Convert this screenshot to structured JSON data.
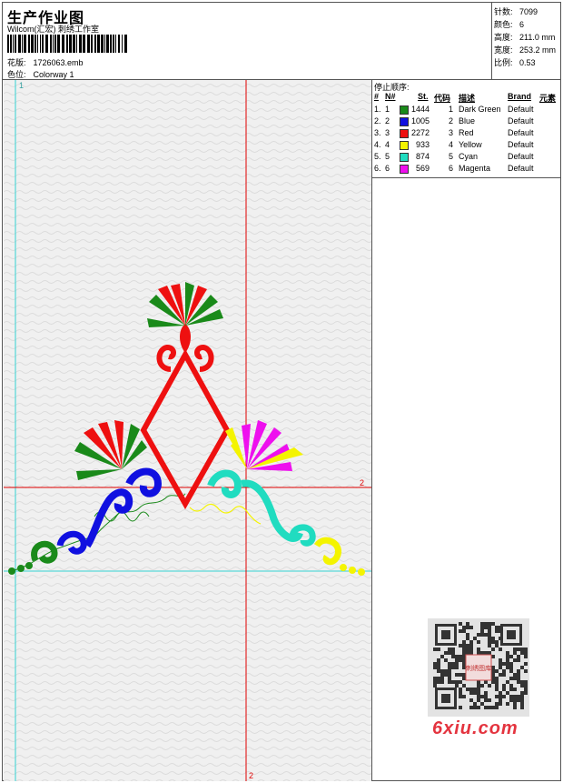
{
  "header": {
    "title": "生产作业图",
    "studio": "Wilcom(汇宏) 刺绣工作室",
    "design_label": "花版:",
    "design_file": "1726063.emb",
    "colorway_label": "色位:",
    "colorway": "Colorway 1"
  },
  "specs": [
    {
      "label": "针数:",
      "value": "7099"
    },
    {
      "label": "颜色:",
      "value": "6"
    },
    {
      "label": "高度:",
      "value": "211.0 mm"
    },
    {
      "label": "宽度:",
      "value": "253.2 mm"
    },
    {
      "label": "比例:",
      "value": "0.53"
    }
  ],
  "sequence": {
    "title": "停止顺序:",
    "headers": [
      "#",
      "N#",
      "St.",
      "代码",
      "描述",
      "Brand",
      "元素"
    ],
    "rows": [
      {
        "idx": "1.",
        "n": "1",
        "color": "#1a8a1a",
        "st": "1444",
        "code": "1",
        "desc": "Dark Green",
        "brand": "Default"
      },
      {
        "idx": "2.",
        "n": "2",
        "color": "#1010e0",
        "st": "1005",
        "code": "2",
        "desc": "Blue",
        "brand": "Default"
      },
      {
        "idx": "3.",
        "n": "3",
        "color": "#ee1010",
        "st": "2272",
        "code": "3",
        "desc": "Red",
        "brand": "Default"
      },
      {
        "idx": "4.",
        "n": "4",
        "color": "#f4f400",
        "st": "933",
        "code": "4",
        "desc": "Yellow",
        "brand": "Default"
      },
      {
        "idx": "5.",
        "n": "5",
        "color": "#20dcc0",
        "st": "874",
        "code": "5",
        "desc": "Cyan",
        "brand": "Default"
      },
      {
        "idx": "6.",
        "n": "6",
        "color": "#ee10ee",
        "st": "569",
        "code": "6",
        "desc": "Magenta",
        "brand": "Default"
      }
    ]
  },
  "canvas": {
    "guide_label_left": "1",
    "guide_label_right": "2",
    "guide_label_bottom": "2"
  },
  "watermark": {
    "site": "6xiu.com",
    "qr_badge": "刺绣图库"
  },
  "icons": {
    "barcode": "barcode-icon",
    "qr": "qr-code-icon"
  }
}
